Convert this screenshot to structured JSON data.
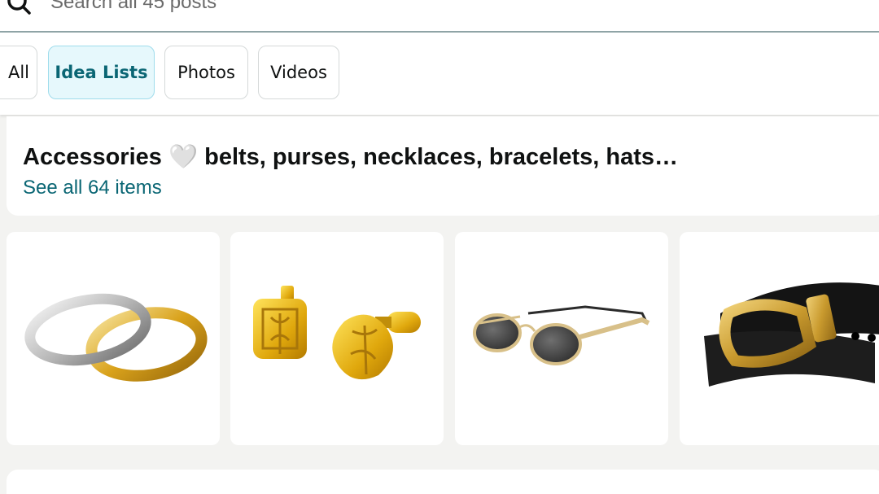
{
  "search": {
    "placeholder": "Search all 45 posts"
  },
  "tabs": [
    {
      "label": "All",
      "active": false
    },
    {
      "label": "Idea Lists",
      "active": true
    },
    {
      "label": "Photos",
      "active": false
    },
    {
      "label": "Videos",
      "active": false
    }
  ],
  "idea_list": {
    "title": "Accessories 🤍 belts, purses, necklaces, bracelets, hats…",
    "see_all_label": "See all 64 items"
  },
  "products": [
    {
      "icon": "rings-image"
    },
    {
      "icon": "earrings-image"
    },
    {
      "icon": "sunglasses-image"
    },
    {
      "icon": "belt-image"
    }
  ],
  "colors": {
    "accent_teal": "#0a6674",
    "active_tab_bg": "#e6f8fc",
    "active_tab_border": "#9fdcec",
    "page_bg": "#f3f3f1",
    "gold": "#d9a21b"
  }
}
